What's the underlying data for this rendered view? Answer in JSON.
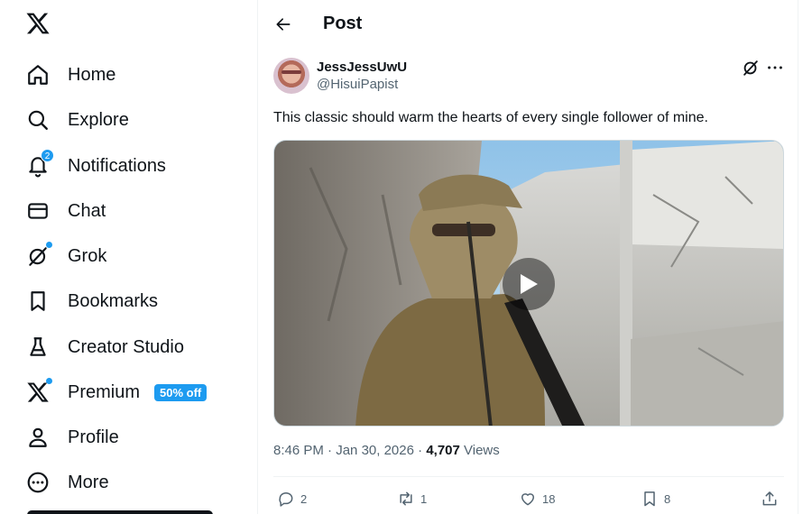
{
  "nav": {
    "items": [
      {
        "label": "Home",
        "icon": "home-icon"
      },
      {
        "label": "Explore",
        "icon": "search-icon"
      },
      {
        "label": "Notifications",
        "icon": "bell-icon",
        "badge": "2"
      },
      {
        "label": "Chat",
        "icon": "mail-icon"
      },
      {
        "label": "Grok",
        "icon": "grok-icon"
      },
      {
        "label": "Bookmarks",
        "icon": "bookmark-icon"
      },
      {
        "label": "Creator Studio",
        "icon": "flask-icon"
      },
      {
        "label": "Premium",
        "icon": "x-logo-icon",
        "promo": "50% off"
      },
      {
        "label": "Profile",
        "icon": "person-icon"
      },
      {
        "label": "More",
        "icon": "more-circle-icon"
      }
    ]
  },
  "header": {
    "title": "Post"
  },
  "post": {
    "author": {
      "display_name": "JessJessUwU",
      "handle": "@HisuiPapist"
    },
    "text": "This classic should warm the hearts of every single follower of mine.",
    "time": "8:46 PM",
    "separator": " · ",
    "date": "Jan 30, 2026",
    "views_count": "4,707",
    "views_label": " Views",
    "stats": {
      "replies": "2",
      "reposts": "1",
      "likes": "18",
      "bookmarks": "8"
    }
  },
  "colors": {
    "accent": "#1d9bf0",
    "text": "#0f1419",
    "secondary": "#536471",
    "border": "#eff3f4"
  }
}
